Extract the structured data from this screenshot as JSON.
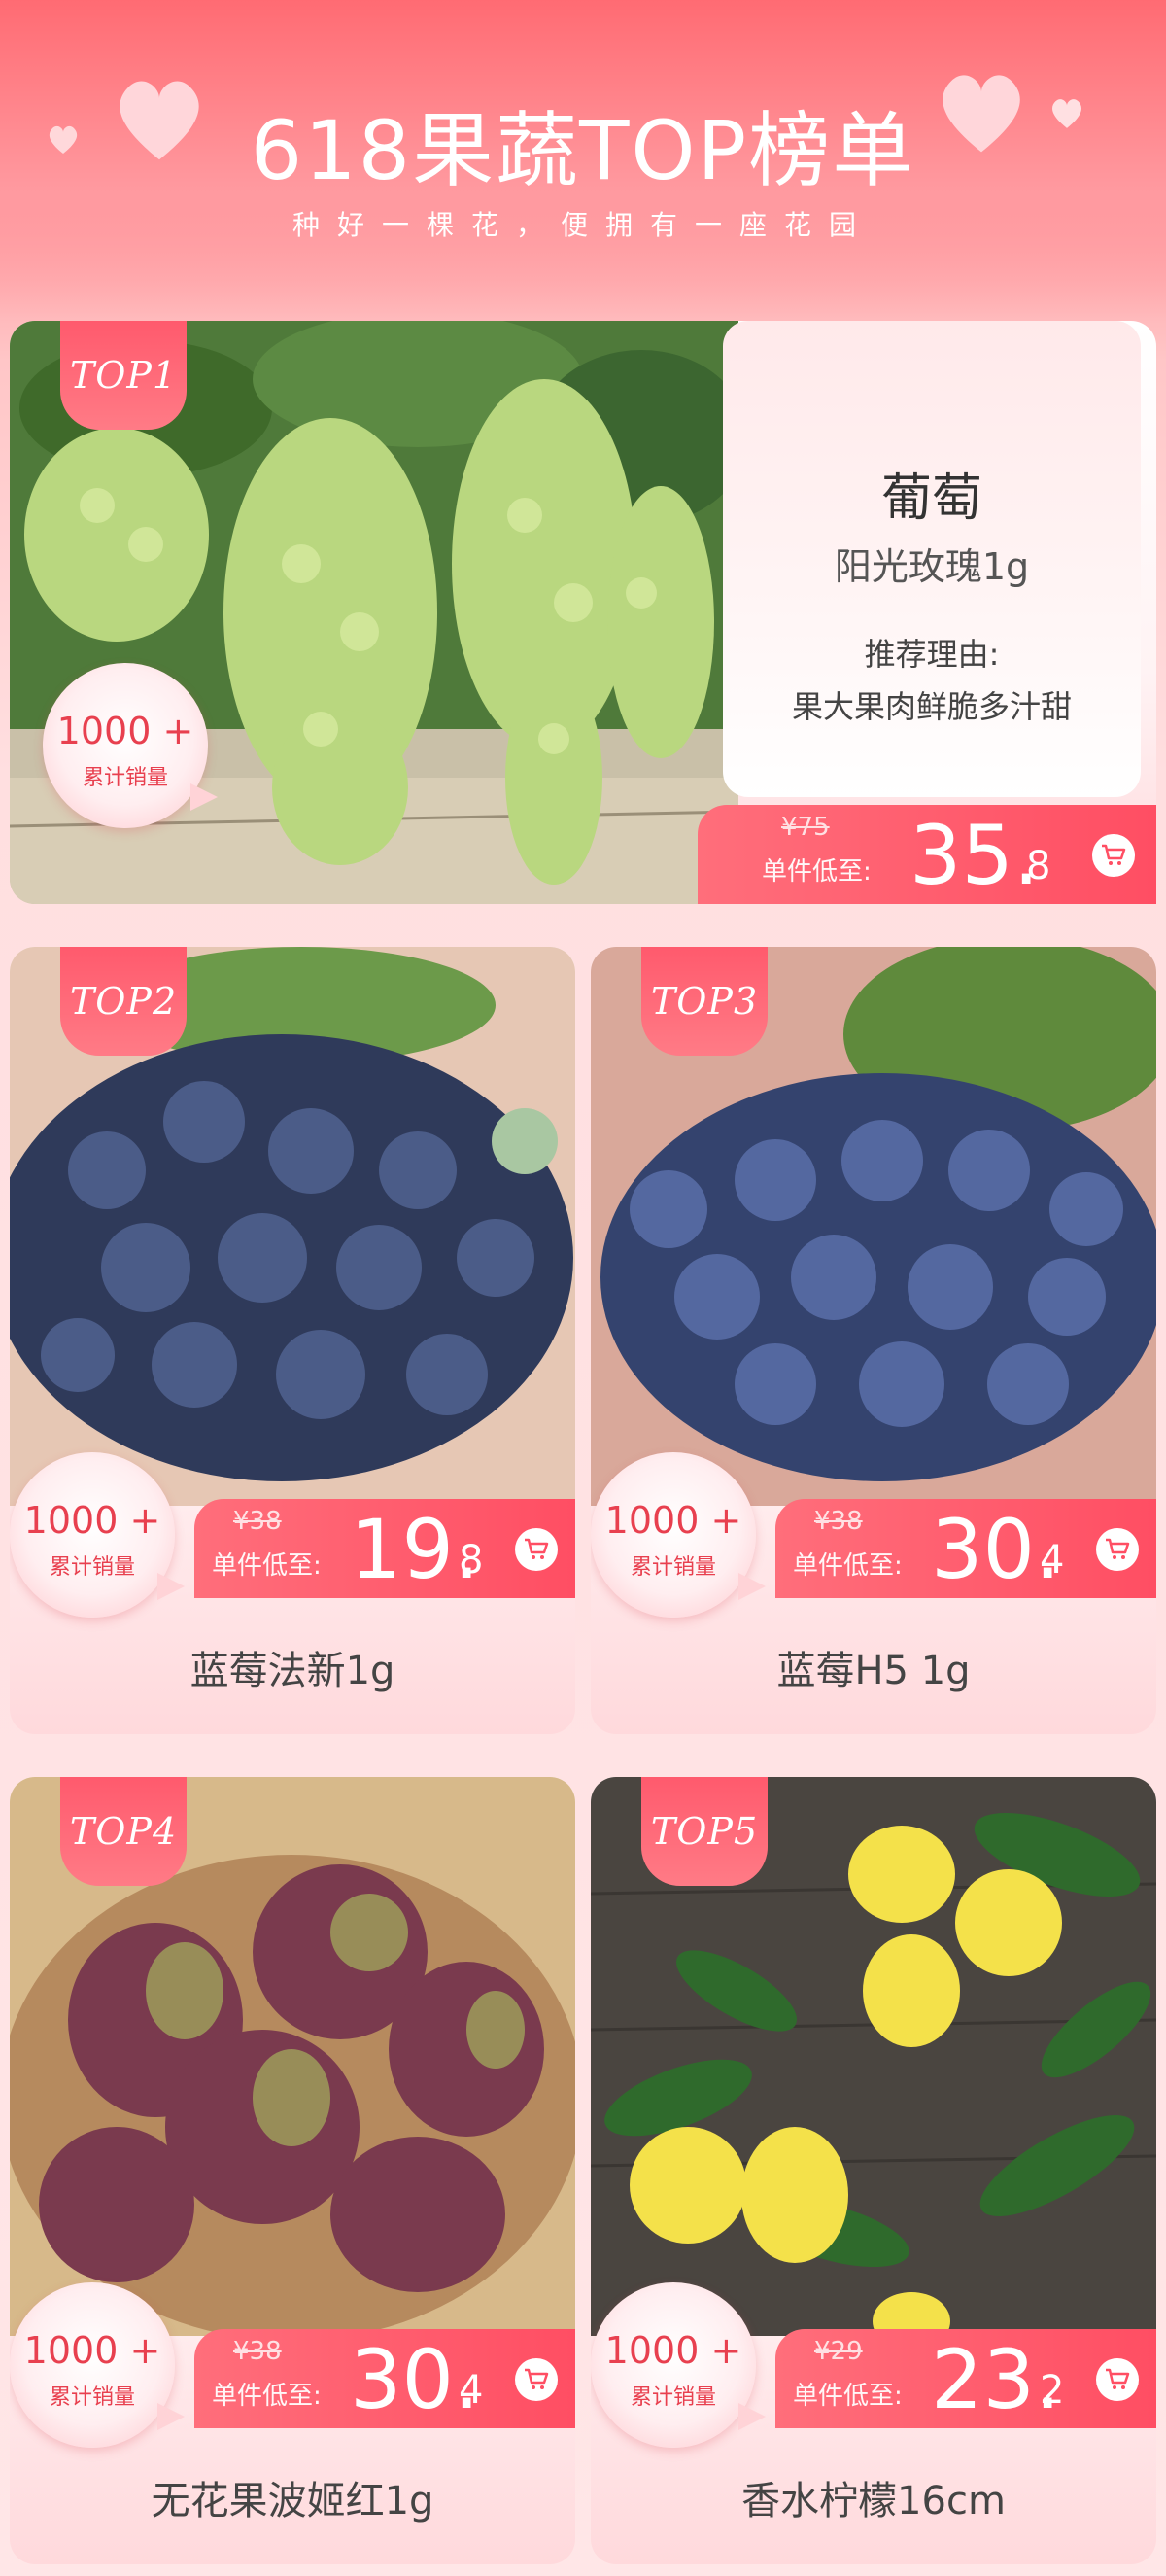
{
  "header": {
    "title": "618果蔬TOP榜单",
    "subtitle": "种好一棵花，便拥有一座花园"
  },
  "colors": {
    "accent": "#ff4e63",
    "badge": "#ff5a6d",
    "sales_text": "#e8404f"
  },
  "common": {
    "sales_count": "1000 +",
    "sales_label": "累计销量",
    "price_label": "单件低至:",
    "cart_icon": "shopping-cart-icon"
  },
  "featured": {
    "rank": "TOP1",
    "name": "葡萄",
    "spec": "阳光玫瑰1g",
    "reason_label": "推荐理由:",
    "reason": "果大果肉鲜脆多汁甜",
    "old_price": "¥75",
    "price_int": "35.",
    "price_dec": "8"
  },
  "products": [
    {
      "rank": "TOP2",
      "name": "蓝莓法新1g",
      "old_price": "¥38",
      "price_int": "19.",
      "price_dec": "8"
    },
    {
      "rank": "TOP3",
      "name": "蓝莓H5 1g",
      "old_price": "¥38",
      "price_int": "30.",
      "price_dec": "4"
    },
    {
      "rank": "TOP4",
      "name": "无花果波姬红1g",
      "old_price": "¥38",
      "price_int": "30.",
      "price_dec": "4"
    },
    {
      "rank": "TOP5",
      "name": "香水柠檬16cm",
      "old_price": "¥29",
      "price_int": "23.",
      "price_dec": "2"
    }
  ]
}
